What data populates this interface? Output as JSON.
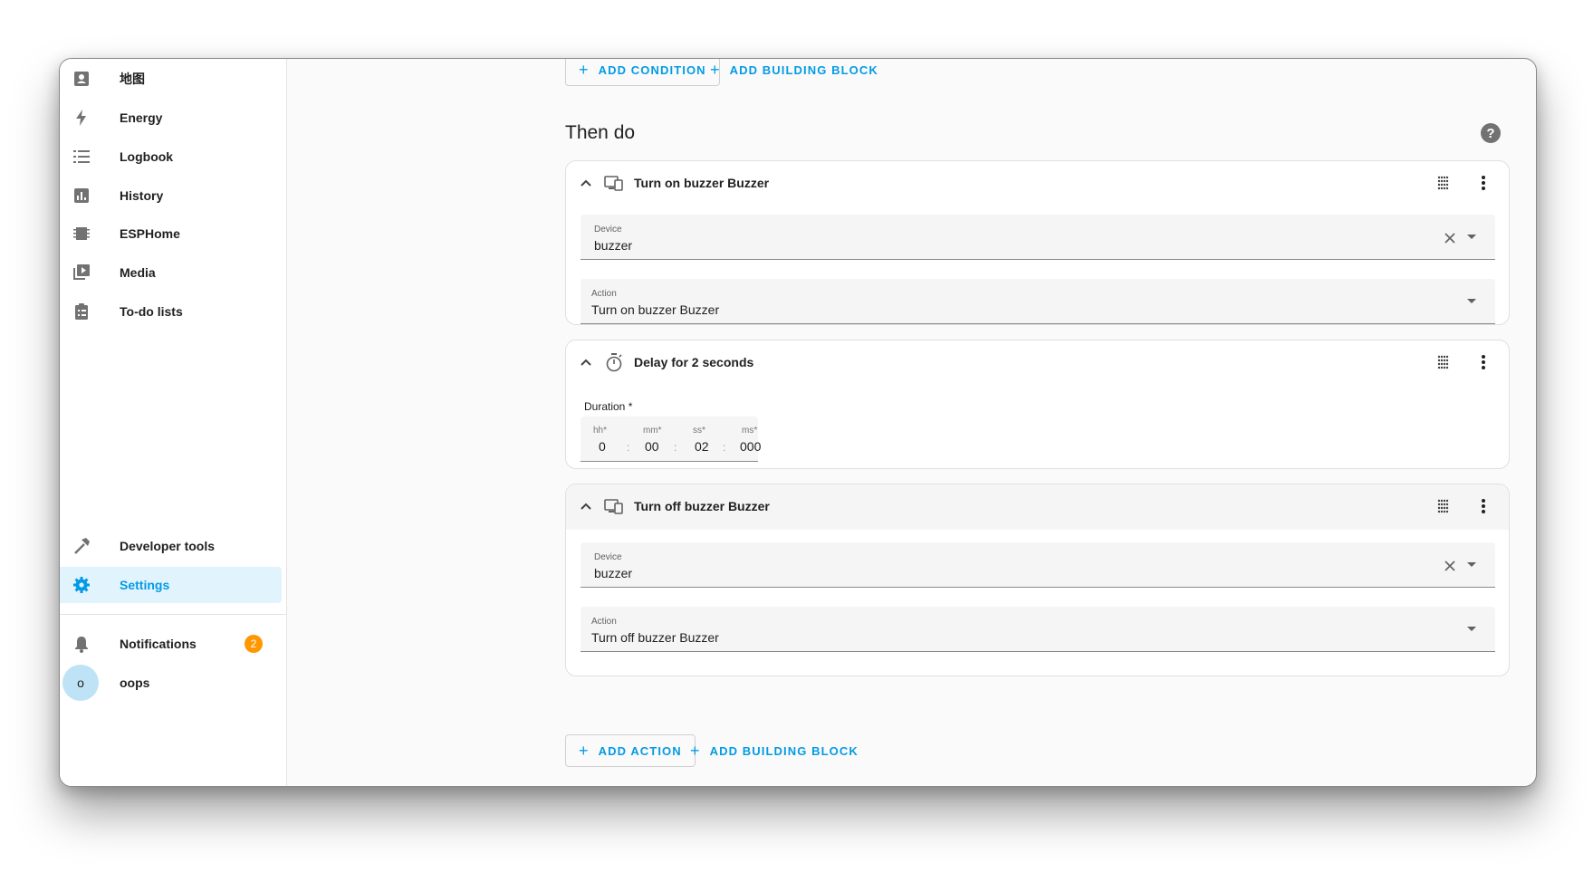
{
  "sidebar": {
    "items": [
      {
        "label": "地图",
        "icon": "map-icon"
      },
      {
        "label": "Energy",
        "icon": "lightning-icon"
      },
      {
        "label": "Logbook",
        "icon": "list-icon"
      },
      {
        "label": "History",
        "icon": "chart-icon"
      },
      {
        "label": "ESPHome",
        "icon": "chip-icon"
      },
      {
        "label": "Media",
        "icon": "play-box-icon"
      },
      {
        "label": "To-do lists",
        "icon": "clipboard-icon"
      }
    ],
    "developer_tools": "Developer tools",
    "settings": "Settings",
    "notifications": "Notifications",
    "notification_count": "2",
    "user_initial": "o",
    "user_name": "oops"
  },
  "top_actions": {
    "add_condition": "ADD CONDITION",
    "add_building_block": "ADD BUILDING BLOCK"
  },
  "section": {
    "title": "Then do",
    "help": "?"
  },
  "actions": [
    {
      "title": "Turn on buzzer Buzzer",
      "device_label": "Device",
      "device_value": "buzzer",
      "action_label": "Action",
      "action_value": "Turn on buzzer Buzzer"
    },
    {
      "title": "Delay for 2 seconds",
      "duration_label": "Duration *",
      "hh_label": "hh*",
      "hh": "0",
      "mm_label": "mm*",
      "mm": "00",
      "ss_label": "ss*",
      "ss": "02",
      "ms_label": "ms*",
      "ms": "000",
      "sep": ":"
    },
    {
      "title": "Turn off buzzer Buzzer",
      "device_label": "Device",
      "device_value": "buzzer",
      "action_label": "Action",
      "action_value": "Turn off buzzer Buzzer"
    }
  ],
  "bottom_actions": {
    "add_action": "ADD ACTION",
    "add_building_block": "ADD BUILDING BLOCK"
  },
  "colors": {
    "accent": "#039be5",
    "active_bg": "#e1f3fc",
    "badge": "#ff9800",
    "icon": "#727272"
  }
}
